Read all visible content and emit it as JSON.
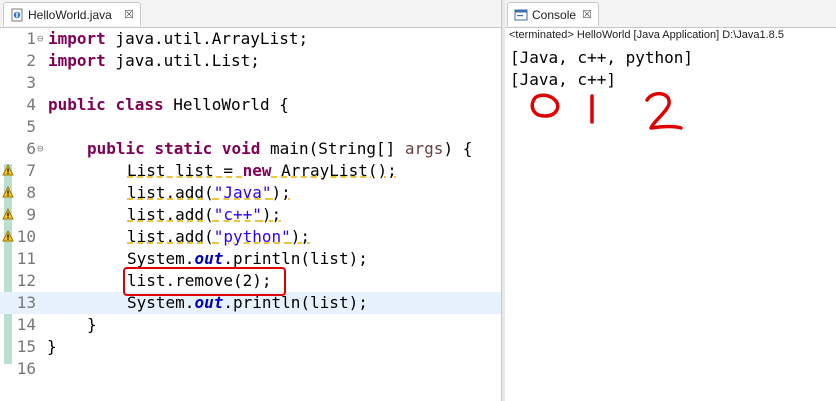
{
  "editor": {
    "tab": {
      "title": "HelloWorld.java",
      "close": "☒"
    },
    "lines": [
      {
        "num": "1",
        "fold": "⊖"
      },
      {
        "num": "2"
      },
      {
        "num": "3"
      },
      {
        "num": "4"
      },
      {
        "num": "5"
      },
      {
        "num": "6",
        "fold": "⊖"
      },
      {
        "num": "7"
      },
      {
        "num": "8"
      },
      {
        "num": "9"
      },
      {
        "num": "10"
      },
      {
        "num": "11"
      },
      {
        "num": "12"
      },
      {
        "num": "13"
      },
      {
        "num": "14"
      },
      {
        "num": "15"
      },
      {
        "num": "16"
      }
    ],
    "code": {
      "l1_kw": "import",
      "l1_rest": " java.util.ArrayList;",
      "l2_kw": "import",
      "l2_rest": " java.util.List;",
      "l4_kw1": "public",
      "l4_kw2": "class",
      "l4_rest": " HelloWorld {",
      "l6_kw1": "public",
      "l6_kw2": "static",
      "l6_kw3": "void",
      "l6_mid": " main(String[] ",
      "l6_param": "args",
      "l6_end": ") {",
      "l7_a": "List list = ",
      "l7_kw": "new",
      "l7_b": " ArrayList();",
      "l8_a": "list.add(",
      "l8_str": "\"Java\"",
      "l8_b": ");",
      "l9_a": "list.add(",
      "l9_str": "\"c++\"",
      "l9_b": ");",
      "l10_a": "list.add(",
      "l10_str": "\"python\"",
      "l10_b": ");",
      "l11_a": "System.",
      "l11_fld": "out",
      "l11_b": ".println(list);",
      "l12": "list.remove(2);",
      "l13_a": "System.",
      "l13_fld": "out",
      "l13_b": ".println(list);",
      "l14": "}",
      "l15": "}"
    }
  },
  "console": {
    "tab": {
      "title": "Console",
      "close": "☒"
    },
    "status": "<terminated> HelloWorld [Java Application] D:\\Java1.8.5",
    "output": [
      "[Java, c++, python]",
      "[Java, c++]"
    ]
  },
  "annotation": {
    "marks": [
      "0",
      "1",
      "2"
    ],
    "color": "#e00000"
  },
  "icons": {
    "java-file": "java-file-icon",
    "console": "console-icon",
    "warning": "warning-icon"
  }
}
